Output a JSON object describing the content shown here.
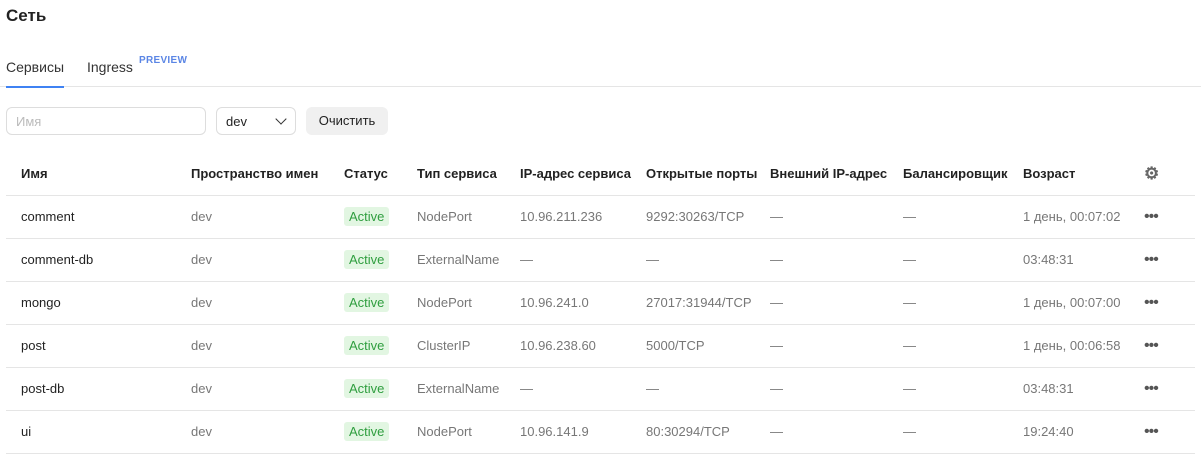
{
  "page_title": "Сеть",
  "tabs": [
    {
      "label": "Сервисы"
    },
    {
      "label": "Ingress",
      "badge": "PREVIEW"
    }
  ],
  "filters": {
    "name_placeholder": "Имя",
    "namespace": "dev",
    "clear_label": "Очистить"
  },
  "columns": [
    "Имя",
    "Пространство имен",
    "Статус",
    "Тип сервиса",
    "IP-адрес сервиса",
    "Открытые порты",
    "Внешний IP-адрес",
    "Балансировщик",
    "Возраст"
  ],
  "rows": [
    {
      "name": "comment",
      "ns": "dev",
      "status": "Active",
      "type": "NodePort",
      "ip": "10.96.211.236",
      "ports": "9292:30263/TCP",
      "ext": "—",
      "lb": "—",
      "age": "1 день, 00:07:02"
    },
    {
      "name": "comment-db",
      "ns": "dev",
      "status": "Active",
      "type": "ExternalName",
      "ip": "—",
      "ports": "—",
      "ext": "—",
      "lb": "—",
      "age": "03:48:31"
    },
    {
      "name": "mongo",
      "ns": "dev",
      "status": "Active",
      "type": "NodePort",
      "ip": "10.96.241.0",
      "ports": "27017:31944/TCP",
      "ext": "—",
      "lb": "—",
      "age": "1 день, 00:07:00"
    },
    {
      "name": "post",
      "ns": "dev",
      "status": "Active",
      "type": "ClusterIP",
      "ip": "10.96.238.60",
      "ports": "5000/TCP",
      "ext": "—",
      "lb": "—",
      "age": "1 день, 00:06:58"
    },
    {
      "name": "post-db",
      "ns": "dev",
      "status": "Active",
      "type": "ExternalName",
      "ip": "—",
      "ports": "—",
      "ext": "—",
      "lb": "—",
      "age": "03:48:31"
    },
    {
      "name": "ui",
      "ns": "dev",
      "status": "Active",
      "type": "NodePort",
      "ip": "10.96.141.9",
      "ports": "80:30294/TCP",
      "ext": "—",
      "lb": "—",
      "age": "19:24:40"
    }
  ],
  "icons": {
    "settings": "gear-icon",
    "row_menu": "more-icon"
  }
}
